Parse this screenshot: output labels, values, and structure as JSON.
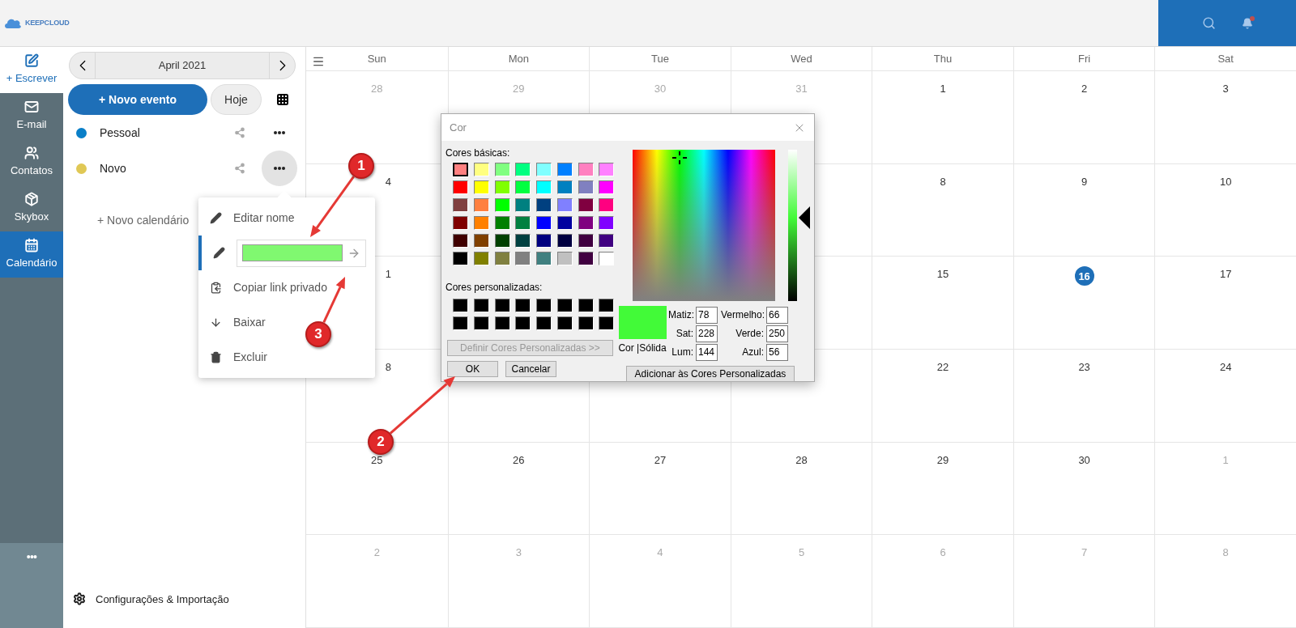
{
  "header": {
    "logo_text": "KEEPCLOUD"
  },
  "nav": [
    {
      "kind": "compose",
      "label": "+ Escrever",
      "selected": false
    },
    {
      "kind": "mail",
      "label": "E-mail",
      "selected": false
    },
    {
      "kind": "contacts",
      "label": "Contatos",
      "selected": false
    },
    {
      "kind": "box",
      "label": "Skybox",
      "selected": false
    },
    {
      "kind": "calendar",
      "label": "Calendário",
      "selected": true
    }
  ],
  "nav_more": "•••",
  "sidebar": {
    "month": "April 2021",
    "new_event": "+ Novo evento",
    "today": "Hoje",
    "calendars": [
      {
        "name": "Pessoal",
        "color": "#0a7fc8",
        "menu_open": false
      },
      {
        "name": "Novo",
        "color": "#e0c855",
        "menu_open": true
      }
    ],
    "new_calendar": "+ Novo calendário",
    "settings": "Configurações & Importação"
  },
  "menu": {
    "items": [
      {
        "kind": "edit",
        "label": "Editar nome",
        "selected": false
      },
      {
        "kind": "color",
        "color": "#80f870",
        "selected": true
      },
      {
        "kind": "copy",
        "label": "Copiar link privado",
        "selected": false
      },
      {
        "kind": "download",
        "label": "Baixar",
        "selected": false
      },
      {
        "kind": "delete",
        "label": "Excluir",
        "selected": false
      }
    ]
  },
  "calendar": {
    "days_of_week": [
      "Sun",
      "Mon",
      "Tue",
      "Wed",
      "Thu",
      "Fri",
      "Sat"
    ],
    "weeks": [
      [
        {
          "kind": "other",
          "label": "28"
        },
        {
          "kind": "other",
          "label": "29"
        },
        {
          "kind": "other",
          "label": "30"
        },
        {
          "kind": "other",
          "label": "31"
        },
        {
          "kind": "day",
          "label": "1"
        },
        {
          "kind": "day",
          "label": "2"
        },
        {
          "kind": "day",
          "label": "3"
        }
      ],
      [
        {
          "kind": "partial",
          "label": "4"
        },
        {
          "kind": "covered"
        },
        {
          "kind": "covered"
        },
        {
          "kind": "covered"
        },
        {
          "kind": "day",
          "label": "8"
        },
        {
          "kind": "day",
          "label": "9"
        },
        {
          "kind": "day",
          "label": "10"
        }
      ],
      [
        {
          "kind": "partial",
          "label": "1"
        },
        {
          "kind": "covered"
        },
        {
          "kind": "covered"
        },
        {
          "kind": "covered"
        },
        {
          "kind": "day",
          "label": "15"
        },
        {
          "kind": "today",
          "label": "16"
        },
        {
          "kind": "day",
          "label": "17"
        }
      ],
      [
        {
          "kind": "partial",
          "label": "8"
        },
        {
          "kind": "covered"
        },
        {
          "kind": "covered"
        },
        {
          "kind": "covered"
        },
        {
          "kind": "day",
          "label": "22"
        },
        {
          "kind": "day",
          "label": "23"
        },
        {
          "kind": "day",
          "label": "24"
        }
      ],
      [
        {
          "kind": "day",
          "label": "25"
        },
        {
          "kind": "day",
          "label": "26"
        },
        {
          "kind": "day",
          "label": "27"
        },
        {
          "kind": "day",
          "label": "28"
        },
        {
          "kind": "day",
          "label": "29"
        },
        {
          "kind": "day",
          "label": "30"
        },
        {
          "kind": "other",
          "label": "1"
        }
      ],
      [
        {
          "kind": "other",
          "label": "2"
        },
        {
          "kind": "other",
          "label": "3"
        },
        {
          "kind": "other",
          "label": "4"
        },
        {
          "kind": "other",
          "label": "5"
        },
        {
          "kind": "other",
          "label": "6"
        },
        {
          "kind": "other",
          "label": "7"
        },
        {
          "kind": "other",
          "label": "8"
        }
      ]
    ]
  },
  "dialog": {
    "title": "Cor",
    "basic_label": "Cores básicas:",
    "basic_colors": [
      {
        "color": "#ff8080",
        "selected": true
      },
      {
        "color": "#ffff80",
        "selected": false
      },
      {
        "color": "#80ff80",
        "selected": false
      },
      {
        "color": "#00ff80",
        "selected": false
      },
      {
        "color": "#80ffff",
        "selected": false
      },
      {
        "color": "#0080ff",
        "selected": false
      },
      {
        "color": "#ff80c0",
        "selected": false
      },
      {
        "color": "#ff80ff",
        "selected": false
      },
      {
        "color": "#ff0000",
        "selected": false
      },
      {
        "color": "#ffff00",
        "selected": false
      },
      {
        "color": "#80ff00",
        "selected": false
      },
      {
        "color": "#00ff40",
        "selected": false
      },
      {
        "color": "#00ffff",
        "selected": false
      },
      {
        "color": "#0080c0",
        "selected": false
      },
      {
        "color": "#8080c0",
        "selected": false
      },
      {
        "color": "#ff00ff",
        "selected": false
      },
      {
        "color": "#804040",
        "selected": false
      },
      {
        "color": "#ff8040",
        "selected": false
      },
      {
        "color": "#00ff00",
        "selected": false
      },
      {
        "color": "#008080",
        "selected": false
      },
      {
        "color": "#004080",
        "selected": false
      },
      {
        "color": "#8080ff",
        "selected": false
      },
      {
        "color": "#800040",
        "selected": false
      },
      {
        "color": "#ff0080",
        "selected": false
      },
      {
        "color": "#800000",
        "selected": false
      },
      {
        "color": "#ff8000",
        "selected": false
      },
      {
        "color": "#008000",
        "selected": false
      },
      {
        "color": "#008040",
        "selected": false
      },
      {
        "color": "#0000ff",
        "selected": false
      },
      {
        "color": "#0000a0",
        "selected": false
      },
      {
        "color": "#800080",
        "selected": false
      },
      {
        "color": "#8000ff",
        "selected": false
      },
      {
        "color": "#400000",
        "selected": false
      },
      {
        "color": "#804000",
        "selected": false
      },
      {
        "color": "#004000",
        "selected": false
      },
      {
        "color": "#004040",
        "selected": false
      },
      {
        "color": "#000080",
        "selected": false
      },
      {
        "color": "#000040",
        "selected": false
      },
      {
        "color": "#400040",
        "selected": false
      },
      {
        "color": "#400080",
        "selected": false
      },
      {
        "color": "#000000",
        "selected": false
      },
      {
        "color": "#808000",
        "selected": false
      },
      {
        "color": "#808040",
        "selected": false
      },
      {
        "color": "#808080",
        "selected": false
      },
      {
        "color": "#408080",
        "selected": false
      },
      {
        "color": "#c0c0c0",
        "selected": false
      },
      {
        "color": "#400040",
        "selected": false
      },
      {
        "color": "#ffffff",
        "selected": false
      }
    ],
    "custom_label": "Cores personalizadas:",
    "custom_colors": [
      {
        "color": "#000000"
      },
      {
        "color": "#000000"
      },
      {
        "color": "#000000"
      },
      {
        "color": "#000000"
      },
      {
        "color": "#000000"
      },
      {
        "color": "#000000"
      },
      {
        "color": "#000000"
      },
      {
        "color": "#000000"
      },
      {
        "color": "#000000"
      },
      {
        "color": "#000000"
      },
      {
        "color": "#000000"
      },
      {
        "color": "#000000"
      },
      {
        "color": "#000000"
      },
      {
        "color": "#000000"
      },
      {
        "color": "#000000"
      },
      {
        "color": "#000000"
      }
    ],
    "define_button": {
      "label": "Definir Cores Personalizadas >>",
      "disabled": true
    },
    "ok": "OK",
    "cancel": "Cancelar",
    "preview_label": "Cor |Sólida",
    "hsl_fields": [
      {
        "label": "Matiz:",
        "value": "78"
      },
      {
        "label": "Sat:",
        "value": "228"
      },
      {
        "label": "Lum:",
        "value": "144"
      }
    ],
    "rgb_fields": [
      {
        "label": "Vermelho:",
        "value": "66"
      },
      {
        "label": "Verde:",
        "value": "250"
      },
      {
        "label": "Azul:",
        "value": "56"
      }
    ],
    "add_button": "Adicionar às Cores Personalizadas"
  },
  "annotations": [
    {
      "label": "1"
    },
    {
      "label": "2"
    },
    {
      "label": "3"
    }
  ]
}
